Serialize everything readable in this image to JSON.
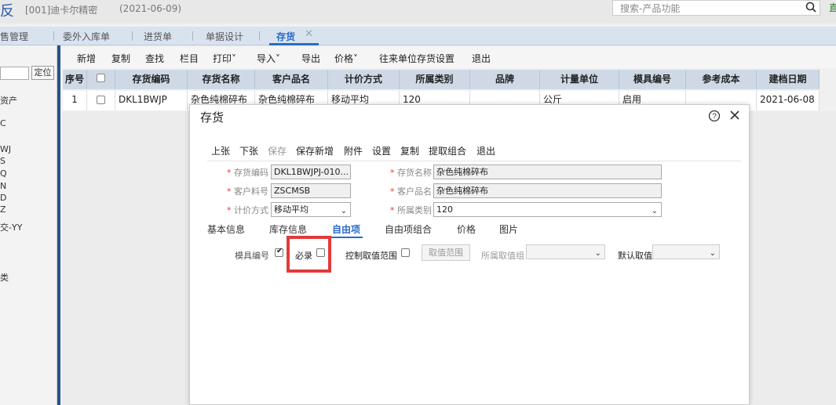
{
  "titlebar": {
    "app_mark": "反",
    "company": "[001]迪卡尔精密",
    "date": "(2021-06-09)",
    "search_placeholder": "搜索-产品功能",
    "help_mark": "直"
  },
  "tabs": [
    {
      "label": "售管理"
    },
    {
      "label": "委外入库单"
    },
    {
      "label": "进货单"
    },
    {
      "label": "单据设计"
    },
    {
      "label": "存货",
      "active": true
    }
  ],
  "left_panel": {
    "locate_label": "定位",
    "items": [
      "资产",
      "",
      "C",
      "",
      "WJ",
      "S",
      "Q",
      "N",
      "D",
      "Z",
      "交-YY",
      "",
      "",
      "",
      "类"
    ]
  },
  "toolbar": {
    "buttons": [
      "新增",
      "复制",
      "查找",
      "栏目",
      "打印˅",
      "导入˅",
      "导出",
      "价格˅",
      "往来单位存货设置",
      "退出"
    ]
  },
  "grid": {
    "columns": [
      "序号",
      "",
      "存货编码",
      "存货名称",
      "客户品名",
      "计价方式",
      "所属类别",
      "品牌",
      "计量单位",
      "模具编号",
      "参考成本",
      "建档日期"
    ],
    "rows": [
      [
        "1",
        "",
        "DKL1BWJP",
        "杂色纯棉碎布",
        "杂色纯棉碎布",
        "移动平均",
        "120",
        "",
        "公斤",
        "启用",
        "",
        "2021-06-08"
      ]
    ]
  },
  "dialog": {
    "title": "存货",
    "toolbar": [
      "上张",
      "下张",
      "保存",
      "保存新增",
      "附件",
      "设置",
      "复制",
      "提取组合",
      "退出"
    ],
    "fields": {
      "code_label": "存货编码",
      "code_value": "DKL1BWJPJ-010...",
      "name_label": "存货名称",
      "name_value": "杂色纯棉碎布",
      "cust_code_label": "客户料号",
      "cust_code_value": "ZSCMSB",
      "cust_name_label": "客户品名",
      "cust_name_value": "杂色纯棉碎布",
      "pricing_label": "计价方式",
      "pricing_value": "移动平均",
      "category_label": "所属类别",
      "category_value": "120"
    },
    "sub_tabs": [
      "基本信息",
      "库存信息",
      "自由项",
      "自由项组合",
      "价格",
      "图片"
    ],
    "free_item_row": {
      "mold_label": "模具编号",
      "required_label": "必录",
      "range_label": "控制取值范围",
      "range_button": "取值范围",
      "group_label": "所属取值组",
      "default_label": "默认取值"
    }
  }
}
